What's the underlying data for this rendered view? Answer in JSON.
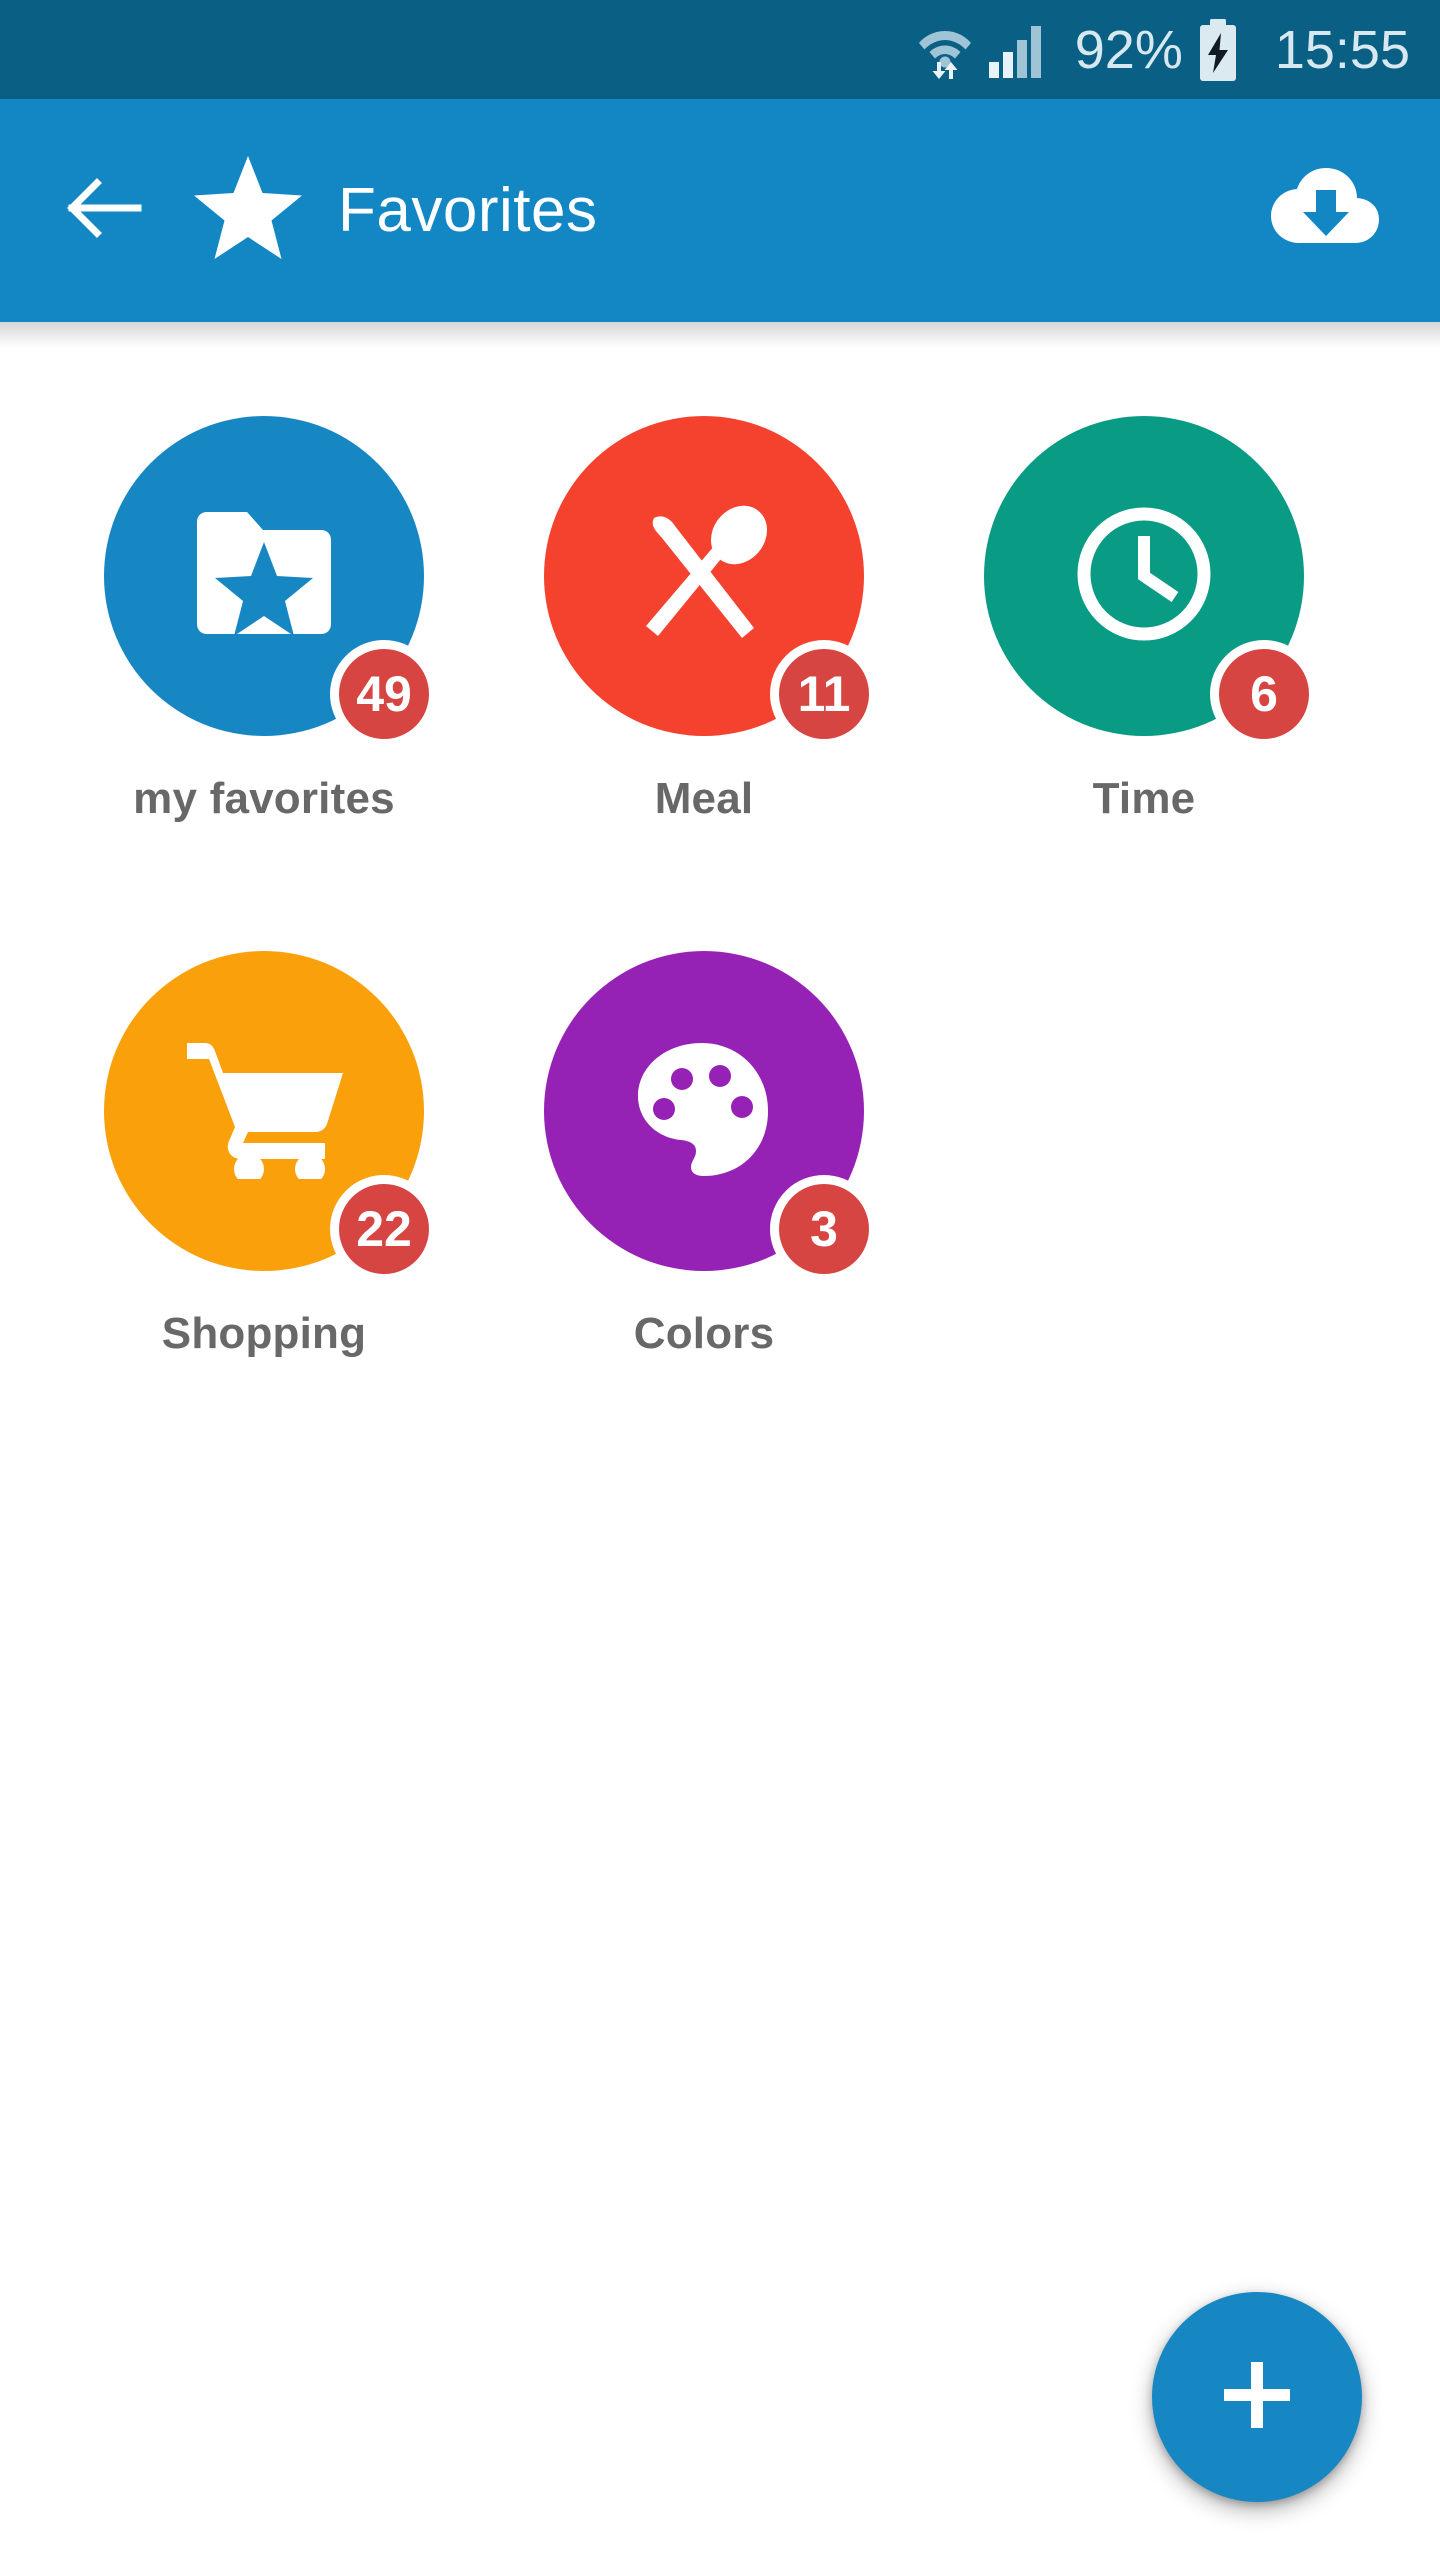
{
  "status_bar": {
    "wifi_icon": "wifi-transfer-icon",
    "signal_icon": "cellular-signal-icon",
    "battery_percent": "92%",
    "battery_icon": "battery-charging-icon",
    "time": "15:55",
    "background_color": "#0a5f85",
    "text_color": "#d8e8f0"
  },
  "app_bar": {
    "back_icon": "arrow-left-icon",
    "logo_icon": "star-icon",
    "title": "Favorites",
    "action_icon": "cloud-download-icon",
    "background_color": "#1287c4",
    "text_color": "#ffffff"
  },
  "folders": [
    {
      "label": "my favorites",
      "count": "49",
      "icon": "folder-star-icon",
      "color": "#1787c4",
      "badge_color": "#d64541"
    },
    {
      "label": "Meal",
      "count": "11",
      "icon": "fork-spoon-icon",
      "color": "#f5422f",
      "badge_color": "#d64541"
    },
    {
      "label": "Time",
      "count": "6",
      "icon": "clock-icon",
      "color": "#099b84",
      "badge_color": "#d64541"
    },
    {
      "label": "Shopping",
      "count": "22",
      "icon": "shopping-cart-icon",
      "color": "#f9a00b",
      "badge_color": "#d64541"
    },
    {
      "label": "Colors",
      "count": "3",
      "icon": "palette-icon",
      "color": "#9622b5",
      "badge_color": "#d64541"
    }
  ],
  "fab": {
    "icon": "plus-icon",
    "color": "#1787c4"
  },
  "theme": {
    "page_background": "#ffffff",
    "label_color": "#686868"
  }
}
